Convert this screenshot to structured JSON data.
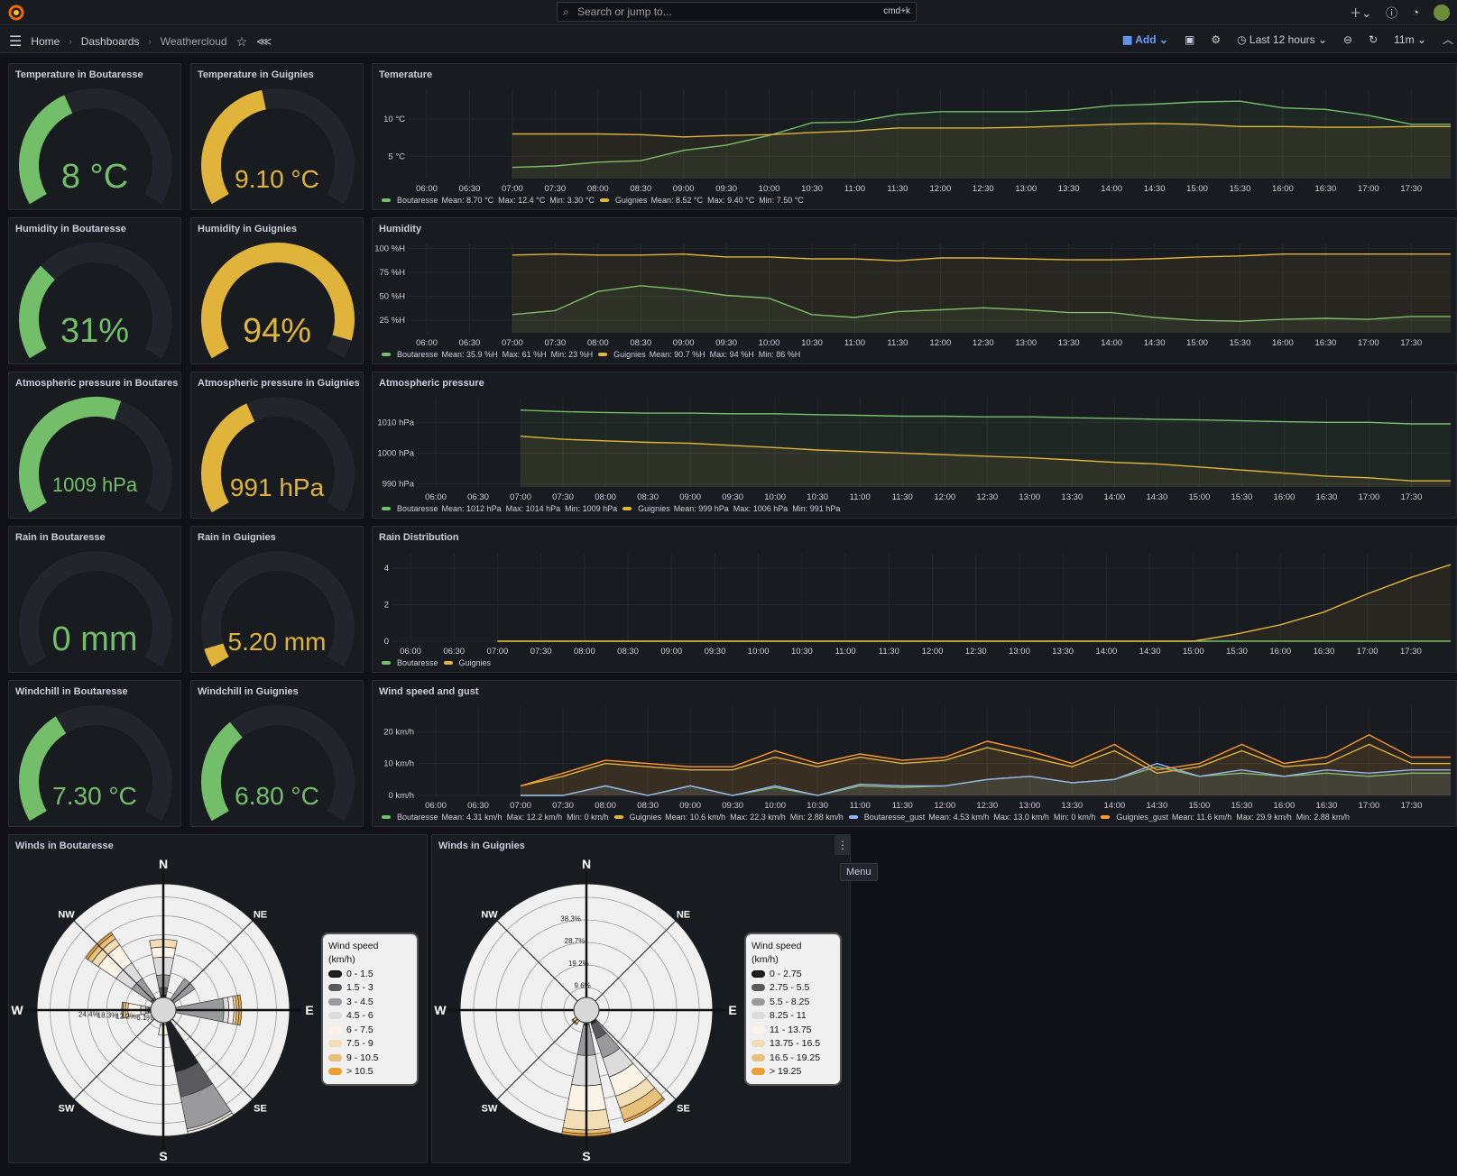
{
  "topbar": {
    "search_placeholder": "Search or jump to...",
    "shortcut": "cmd+k",
    "icons": [
      "grafana-logo-icon",
      "plus-icon",
      "help-icon",
      "rss-icon",
      "avatar"
    ]
  },
  "nav": {
    "breadcrumbs": [
      "Home",
      "Dashboards",
      "Weathercloud"
    ],
    "add_label": "Add",
    "time_range": "Last 12 hours",
    "refresh": "11m"
  },
  "colors": {
    "green": "#73bf69",
    "yellow": "#fade2a",
    "gold": "#e0b400",
    "blue": "#8ab8ff",
    "orange": "#ff9830"
  },
  "gauges": [
    {
      "title": "Temperature in Boutaresse",
      "value": "8 °C",
      "fraction": 0.4,
      "color": "#73bf69"
    },
    {
      "title": "Temperature in Guignies",
      "value": "9.10 °C",
      "fraction": 0.45,
      "color": "#e0b43a"
    },
    {
      "title": "Humidity in Boutaresse",
      "value": "31%",
      "fraction": 0.31,
      "color": "#73bf69"
    },
    {
      "title": "Humidity in Guignies",
      "value": "94%",
      "fraction": 0.94,
      "color": "#e0b43a"
    },
    {
      "title": "Atmospheric pressure in Boutaresse",
      "value": "1009 hPa",
      "fraction": 0.58,
      "color": "#73bf69"
    },
    {
      "title": "Atmospheric pressure in Guignies",
      "value": "991 hPa",
      "fraction": 0.4,
      "color": "#e0b43a"
    },
    {
      "title": "Rain in Boutaresse",
      "value": "0 mm",
      "fraction": 0.0,
      "color": "#73bf69"
    },
    {
      "title": "Rain in Guignies",
      "value": "5.20 mm",
      "fraction": 0.06,
      "color": "#e0b43a"
    },
    {
      "title": "Windchill in Boutaresse",
      "value": "7.30 °C",
      "fraction": 0.37,
      "color": "#73bf69"
    },
    {
      "title": "Windchill in Guignies",
      "value": "6.80 °C",
      "fraction": 0.34,
      "color": "#73bf69"
    }
  ],
  "chart_data": [
    {
      "type": "line",
      "title": "Temerature",
      "x": [
        "06:00",
        "06:30",
        "07:00",
        "07:30",
        "08:00",
        "08:30",
        "09:00",
        "09:30",
        "10:00",
        "10:30",
        "11:00",
        "11:30",
        "12:00",
        "12:30",
        "13:00",
        "13:30",
        "14:00",
        "14:30",
        "15:00",
        "15:30",
        "16:00",
        "16:30",
        "17:00",
        "17:30"
      ],
      "yticks": [
        "5 °C",
        "10 °C"
      ],
      "ylim": [
        2,
        14
      ],
      "series": [
        {
          "name": "Boutaresse",
          "color": "#73bf69",
          "values": [
            null,
            null,
            3.5,
            3.7,
            4.2,
            4.4,
            5.8,
            6.5,
            7.8,
            9.5,
            9.6,
            10.6,
            11.0,
            11.0,
            11.0,
            11.2,
            11.8,
            12.0,
            12.3,
            12.4,
            11.5,
            11.3,
            10.5,
            9.3
          ],
          "legend": "Mean: 8.70 °C  Max: 12.4 °C  Min: 3.30 °C"
        },
        {
          "name": "Guignies",
          "color": "#e0b43a",
          "values": [
            null,
            null,
            8.0,
            8.0,
            8.0,
            7.9,
            7.6,
            7.8,
            7.9,
            8.2,
            8.4,
            8.8,
            8.8,
            8.8,
            8.9,
            9.1,
            9.3,
            9.4,
            9.3,
            9.0,
            9.0,
            8.9,
            8.9,
            9.0
          ],
          "legend": "Mean: 8.52 °C  Max: 9.40 °C  Min: 7.50 °C"
        }
      ]
    },
    {
      "type": "line",
      "title": "Humidity",
      "x": [
        "06:00",
        "06:30",
        "07:00",
        "07:30",
        "08:00",
        "08:30",
        "09:00",
        "09:30",
        "10:00",
        "10:30",
        "11:00",
        "11:30",
        "12:00",
        "12:30",
        "13:00",
        "13:30",
        "14:00",
        "14:30",
        "15:00",
        "15:30",
        "16:00",
        "16:30",
        "17:00",
        "17:30"
      ],
      "yticks": [
        "25 %H",
        "50 %H",
        "75 %H",
        "100 %H"
      ],
      "ylim": [
        12,
        105
      ],
      "series": [
        {
          "name": "Boutaresse",
          "color": "#73bf69",
          "values": [
            null,
            null,
            31,
            35,
            55,
            61,
            57,
            51,
            48,
            31,
            28,
            34,
            36,
            38,
            36,
            33,
            33,
            28,
            25,
            24,
            26,
            27,
            26,
            29
          ],
          "legend": "Mean: 35.9 %H  Max: 61 %H  Min: 23 %H"
        },
        {
          "name": "Guignies",
          "color": "#e0b43a",
          "values": [
            null,
            null,
            93,
            94,
            93,
            93,
            94,
            91,
            91,
            89,
            89,
            87,
            90,
            90,
            89,
            88,
            88,
            89,
            91,
            92,
            94,
            94,
            94,
            94
          ],
          "legend": "Mean: 90.7 %H  Max: 94 %H  Min: 86 %H"
        }
      ]
    },
    {
      "type": "line",
      "title": "Atmospheric pressure",
      "x": [
        "06:00",
        "06:30",
        "07:00",
        "07:30",
        "08:00",
        "08:30",
        "09:00",
        "09:30",
        "10:00",
        "10:30",
        "11:00",
        "11:30",
        "12:00",
        "12:30",
        "13:00",
        "13:30",
        "14:00",
        "14:30",
        "15:00",
        "15:30",
        "16:00",
        "16:30",
        "17:00",
        "17:30"
      ],
      "yticks": [
        "990 hPa",
        "1000 hPa",
        "1010 hPa"
      ],
      "ylim": [
        989,
        1018
      ],
      "series": [
        {
          "name": "Boutaresse",
          "color": "#73bf69",
          "values": [
            null,
            null,
            1014,
            1013.5,
            1013.2,
            1013,
            1013,
            1012.8,
            1012.8,
            1012.5,
            1012.3,
            1012,
            1012,
            1011.8,
            1011.8,
            1011.5,
            1011.3,
            1011,
            1010.8,
            1010.5,
            1010.2,
            1010,
            1010,
            1009.5
          ],
          "legend": "Mean: 1012 hPa  Max: 1014 hPa  Min: 1009 hPa"
        },
        {
          "name": "Guignies",
          "color": "#e0b43a",
          "values": [
            null,
            null,
            1005.5,
            1004.5,
            1004,
            1003.5,
            1003.2,
            1002.5,
            1001.8,
            1001,
            1000.5,
            1000,
            999.5,
            999,
            998.5,
            997.8,
            997,
            996.5,
            995.5,
            994.5,
            993.5,
            992.5,
            992,
            991
          ],
          "legend": "Mean: 999 hPa  Max: 1006 hPa  Min: 991 hPa"
        }
      ]
    },
    {
      "type": "line",
      "title": "Rain Distribution",
      "x": [
        "06:00",
        "06:30",
        "07:00",
        "07:30",
        "08:00",
        "08:30",
        "09:00",
        "09:30",
        "10:00",
        "10:30",
        "11:00",
        "11:30",
        "12:00",
        "12:30",
        "13:00",
        "13:30",
        "14:00",
        "14:30",
        "15:00",
        "15:30",
        "16:00",
        "16:30",
        "17:00",
        "17:30"
      ],
      "yticks": [
        "0",
        "2",
        "4"
      ],
      "ylim": [
        0,
        4.8
      ],
      "series": [
        {
          "name": "Boutaresse",
          "color": "#73bf69",
          "values": [
            null,
            null,
            0,
            0,
            0,
            0,
            0,
            0,
            0,
            0,
            0,
            0,
            0,
            0,
            0,
            0,
            0,
            0,
            0,
            0,
            0,
            0,
            0,
            0
          ],
          "legend": ""
        },
        {
          "name": "Guignies",
          "color": "#e0b43a",
          "values": [
            null,
            null,
            0,
            0,
            0,
            0,
            0,
            0,
            0,
            0,
            0,
            0,
            0,
            0,
            0,
            0,
            0,
            0,
            0,
            0.4,
            0.9,
            1.6,
            2.6,
            3.5
          ],
          "end": 4.2,
          "legend": ""
        }
      ]
    },
    {
      "type": "line",
      "title": "Wind speed and gust",
      "x": [
        "06:00",
        "06:30",
        "07:00",
        "07:30",
        "08:00",
        "08:30",
        "09:00",
        "09:30",
        "10:00",
        "10:30",
        "11:00",
        "11:30",
        "12:00",
        "12:30",
        "13:00",
        "13:30",
        "14:00",
        "14:30",
        "15:00",
        "15:30",
        "16:00",
        "16:30",
        "17:00",
        "17:30"
      ],
      "yticks": [
        "0 km/h",
        "10 km/h",
        "20 km/h"
      ],
      "ylim": [
        0,
        28
      ],
      "series": [
        {
          "name": "Boutaresse",
          "color": "#73bf69",
          "values": [
            null,
            null,
            0,
            0,
            3,
            0,
            3,
            0,
            2.5,
            0,
            3,
            2.5,
            3,
            5,
            6,
            4,
            5,
            9,
            6,
            7,
            6,
            7,
            6,
            7
          ],
          "legend": "Mean: 4.31 km/h  Max: 12.2 km/h  Min: 0 km/h"
        },
        {
          "name": "Guignies",
          "color": "#e0b43a",
          "values": [
            null,
            null,
            3,
            6,
            10,
            9,
            8,
            8,
            12,
            9,
            12,
            10,
            11,
            15,
            12,
            9,
            14,
            7,
            9,
            14,
            9,
            10,
            16,
            10
          ],
          "legend": "Mean: 10.6 km/h  Max: 22.3 km/h  Min: 2.88 km/h"
        },
        {
          "name": "Boutaresse_gust",
          "color": "#8ab8ff",
          "values": [
            null,
            null,
            0,
            0,
            3,
            0,
            3,
            0,
            3,
            0,
            3.5,
            3,
            3,
            5,
            6,
            4,
            5,
            10,
            6,
            8,
            6,
            8,
            7,
            8
          ],
          "legend": "Mean: 4.53 km/h  Max: 13.0 km/h  Min: 0 km/h"
        },
        {
          "name": "Guignies_gust",
          "color": "#ff9830",
          "values": [
            null,
            null,
            3,
            7,
            11,
            10,
            9,
            9,
            14,
            10,
            13,
            11,
            12,
            17,
            14,
            10,
            16,
            8,
            10,
            16,
            10,
            12,
            19,
            12
          ],
          "legend": "Mean: 11.6 km/h  Max: 29.9 km/h  Min: 2.88 km/h"
        }
      ]
    }
  ],
  "windroses": [
    {
      "title": "Winds in Boutaresse",
      "rings": [
        "6.1%",
        "12.2%",
        "18.3%",
        "24.4%"
      ],
      "legend_title": [
        "Wind speed",
        "(km/h)"
      ],
      "bins": [
        "0 - 1.5",
        "1.5 - 3",
        "3 - 4.5",
        "4.5 - 6",
        "6 - 7.5",
        "7.5 - 9",
        "9 - 10.5",
        "> 10.5"
      ]
    },
    {
      "title": "Winds in Guignies",
      "rings": [
        "9.6%",
        "19.2%",
        "28.7%",
        "38.3%"
      ],
      "legend_title": [
        "Wind speed",
        "(km/h)"
      ],
      "bins": [
        "0 - 2.75",
        "2.75 - 5.5",
        "5.5 - 8.25",
        "8.25 - 11",
        "11 - 13.75",
        "13.75 - 16.5",
        "16.5 - 19.25",
        "> 19.25"
      ]
    }
  ],
  "compass": [
    "N",
    "NE",
    "E",
    "SE",
    "S",
    "SW",
    "W",
    "NW"
  ],
  "menu": {
    "tooltip": "Menu"
  }
}
